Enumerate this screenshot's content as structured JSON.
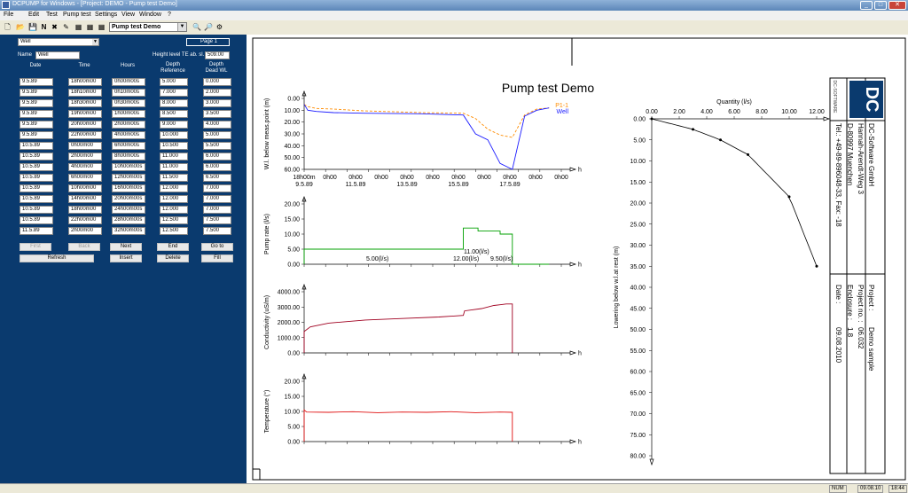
{
  "window": {
    "title": "DCPUMP for Windows - [Project: DEMO - Pump test Demo]"
  },
  "menu": [
    "File",
    "Edit",
    "Test",
    "Pump test",
    "Settings",
    "View",
    "Window",
    "?"
  ],
  "toolbar": {
    "selected_test": "Pump test Demo"
  },
  "form": {
    "well_select": "Well",
    "page_label": "Page 1",
    "name_label": "Name",
    "name_value": "Well",
    "height_label": "Height level TE ab. sl.",
    "height_value": "509.00",
    "col_headers": {
      "date": "Date",
      "time": "Time",
      "hours": "Hours",
      "depth_ref_1": "Depth",
      "depth_ref_2": "Reference",
      "depth_dead_1": "Depth",
      "depth_dead_2": "Dead WL"
    },
    "rows": [
      [
        "9.5.89",
        "18h00m00",
        "0h00m00s",
        "5.000",
        "0.000"
      ],
      [
        "9.5.89",
        "18h10m00",
        "0h10m00s",
        "7.000",
        "2.000"
      ],
      [
        "9.5.89",
        "18h30m00",
        "0h30m00s",
        "8.000",
        "3.000"
      ],
      [
        "9.5.89",
        "19h00m00",
        "1h00m00s",
        "8.500",
        "3.500"
      ],
      [
        "9.5.89",
        "20h00m00",
        "2h00m00s",
        "9.000",
        "4.000"
      ],
      [
        "9.5.89",
        "22h00m00",
        "4h00m00s",
        "10.000",
        "5.000"
      ],
      [
        "10.5.89",
        "0h00m00",
        "6h00m00s",
        "10.500",
        "5.500"
      ],
      [
        "10.5.89",
        "2h00m00",
        "8h00m00s",
        "11.000",
        "6.000"
      ],
      [
        "10.5.89",
        "4h00m00",
        "10h00m00s",
        "11.000",
        "6.000"
      ],
      [
        "10.5.89",
        "6h00m00",
        "12h00m00s",
        "11.500",
        "6.500"
      ],
      [
        "10.5.89",
        "10h00m00",
        "16h00m00s",
        "12.000",
        "7.000"
      ],
      [
        "10.5.89",
        "14h00m00",
        "20h00m00s",
        "12.000",
        "7.000"
      ],
      [
        "10.5.89",
        "18h00m00",
        "24h00m00s",
        "12.000",
        "7.000"
      ],
      [
        "10.5.89",
        "22h00m00",
        "28h00m00s",
        "12.500",
        "7.500"
      ],
      [
        "11.5.89",
        "2h00m00",
        "32h00m00s",
        "12.500",
        "7.500"
      ]
    ],
    "buttons": {
      "first": "First",
      "back": "Back",
      "next": "Next",
      "end": "End",
      "goto": "Go to",
      "refresh": "Refresh",
      "insert": "Insert",
      "delete": "Delete",
      "fill": "Fill"
    }
  },
  "report": {
    "title": "Pump test Demo",
    "company": {
      "name": "DC-Software GmbH",
      "street": "Hannah-Arendt-Weg 3",
      "city": "D-80997 Muenchen",
      "tel": "Tel.: +49-89-896048-33, Fax: -18"
    },
    "project_label": "Project :",
    "project_value": "Demo sample",
    "projno_label": "Project no. :",
    "projno_value": "06.032",
    "enclosure_label": "Enclosure :",
    "enclosure_value": "1.8",
    "date_label": "Date :",
    "date_value": "09.08.2010",
    "logo_text": "DC",
    "logo_small": "DC-SOFTWARE"
  },
  "chart_data": [
    {
      "type": "line",
      "ylabel": "W.l. below meas.point (m)",
      "ylim": [
        60,
        0
      ],
      "y_ticks": [
        "0.00",
        "10.00",
        "20.00",
        "30.00",
        "40.00",
        "50.00",
        "60.00"
      ],
      "x_tick_labels": [
        "18h00m",
        "0h00",
        "0h00",
        "0h00",
        "0h00",
        "0h00",
        "0h00",
        "0h00",
        "0h00",
        "0h00",
        "0h00"
      ],
      "x_date_labels": [
        "9.5.89",
        "11.5.89",
        "13.5.89",
        "15.5.89",
        "17.5.89"
      ],
      "axis_unit": "h",
      "series": [
        {
          "name": "P1-1",
          "color": "#ff8c00",
          "style": "dashed",
          "x": [
            0,
            3,
            10,
            24,
            48,
            96,
            130,
            140,
            150,
            160,
            170,
            180,
            190,
            200
          ],
          "y": [
            5,
            7,
            8.5,
            9,
            10.5,
            12,
            12.5,
            17,
            26,
            31,
            33,
            14,
            9,
            8
          ]
        },
        {
          "name": "Well",
          "color": "#1a1aff",
          "style": "solid",
          "x": [
            0,
            3,
            10,
            24,
            48,
            96,
            130,
            140,
            150,
            160,
            170,
            180,
            190,
            200
          ],
          "y": [
            5,
            10,
            11,
            12,
            12.5,
            13,
            14,
            30,
            35,
            55,
            60,
            15,
            10,
            8
          ]
        }
      ]
    },
    {
      "type": "line",
      "ylabel": "Pump rate (l/s)",
      "ylim": [
        0,
        20
      ],
      "y_ticks": [
        "0.00",
        "5.00",
        "10.00",
        "15.00",
        "20.00"
      ],
      "axis_unit": "h",
      "annotations": [
        "5.00(l/s)",
        "11.00(l/s)",
        "12.00(l/s)",
        "9.50(l/s)"
      ],
      "series": [
        {
          "color": "#00a000",
          "x": [
            0,
            0,
            130,
            130,
            142,
            142,
            160,
            160,
            170,
            170,
            200
          ],
          "y": [
            0,
            5,
            5,
            12,
            12,
            11,
            11,
            10,
            10,
            0,
            0
          ]
        }
      ]
    },
    {
      "type": "line",
      "ylabel": "Conductivity (uS/m)",
      "ylim": [
        0,
        4000
      ],
      "y_ticks": [
        "0.00",
        "1000.00",
        "2000.00",
        "3000.00",
        "4000.00"
      ],
      "axis_unit": "h",
      "series": [
        {
          "color": "#a00020",
          "x": [
            0,
            0,
            5,
            20,
            50,
            80,
            110,
            130,
            131,
            145,
            155,
            160,
            165,
            170,
            170
          ],
          "y": [
            0,
            1400,
            1700,
            1950,
            2150,
            2250,
            2350,
            2450,
            2750,
            2900,
            3100,
            3150,
            3200,
            3200,
            0
          ]
        }
      ]
    },
    {
      "type": "line",
      "ylabel": "Temperature (°)",
      "ylim": [
        0,
        20
      ],
      "y_ticks": [
        "0.00",
        "5.00",
        "10.00",
        "15.00",
        "20.00"
      ],
      "axis_unit": "h",
      "series": [
        {
          "color": "#e01010",
          "x": [
            0,
            0,
            2,
            20,
            40,
            60,
            80,
            100,
            120,
            140,
            160,
            170,
            170
          ],
          "y": [
            0,
            10.5,
            9.8,
            9.7,
            9.9,
            9.6,
            9.8,
            9.7,
            9.9,
            9.6,
            9.8,
            9.7,
            0
          ]
        }
      ]
    },
    {
      "type": "scatter",
      "xlabel": "Quantity (l/s)",
      "ylabel": "Lowering below w.l.at rest (m)",
      "xlim": [
        0,
        12
      ],
      "ylim": [
        0,
        80
      ],
      "x_ticks": [
        "0.00",
        "2.00",
        "4.00",
        "6.00",
        "8.00",
        "10.00",
        "12.00"
      ],
      "y_ticks": [
        "0.00",
        "5.00",
        "10.00",
        "15.00",
        "20.00",
        "25.00",
        "30.00",
        "35.00",
        "40.00",
        "45.00",
        "50.00",
        "55.00",
        "60.00",
        "65.00",
        "70.00",
        "75.00",
        "80.00"
      ],
      "series": [
        {
          "color": "#000000",
          "x": [
            0,
            3,
            5,
            7,
            10,
            12
          ],
          "y": [
            0,
            2.5,
            5,
            8.5,
            18.5,
            35
          ]
        }
      ]
    }
  ]
}
